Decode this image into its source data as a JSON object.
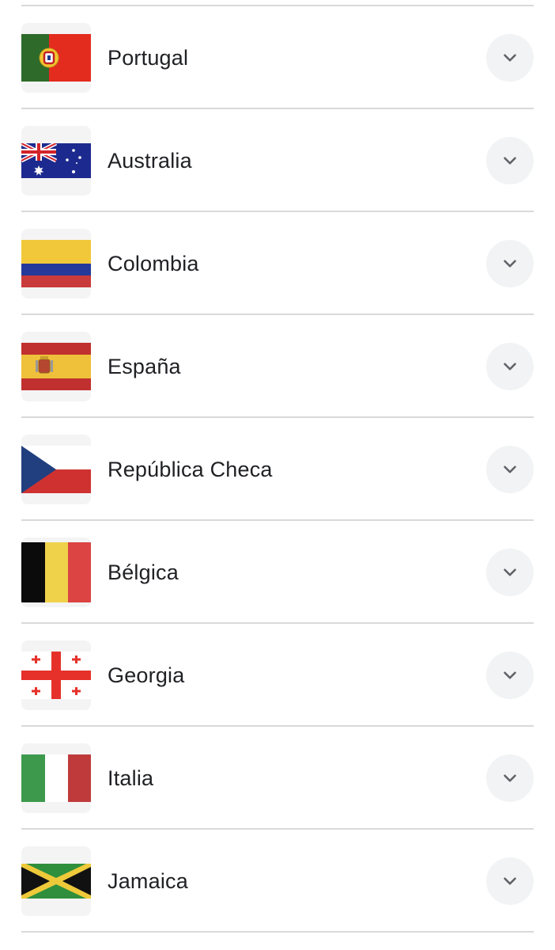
{
  "countries": [
    {
      "name": "Portugal",
      "flag_icon": "portugal-flag-icon"
    },
    {
      "name": "Australia",
      "flag_icon": "australia-flag-icon"
    },
    {
      "name": "Colombia",
      "flag_icon": "colombia-flag-icon"
    },
    {
      "name": "España",
      "flag_icon": "spain-flag-icon"
    },
    {
      "name": "República Checa",
      "flag_icon": "czech-republic-flag-icon"
    },
    {
      "name": "Bélgica",
      "flag_icon": "belgium-flag-icon"
    },
    {
      "name": "Georgia",
      "flag_icon": "georgia-flag-icon"
    },
    {
      "name": "Italia",
      "flag_icon": "italy-flag-icon"
    },
    {
      "name": "Jamaica",
      "flag_icon": "jamaica-flag-icon"
    }
  ],
  "colors": {
    "divider": "#d9d9d9",
    "chevron_button_bg": "#f1f3f4",
    "chevron": "#5f6368",
    "text": "#202124"
  }
}
